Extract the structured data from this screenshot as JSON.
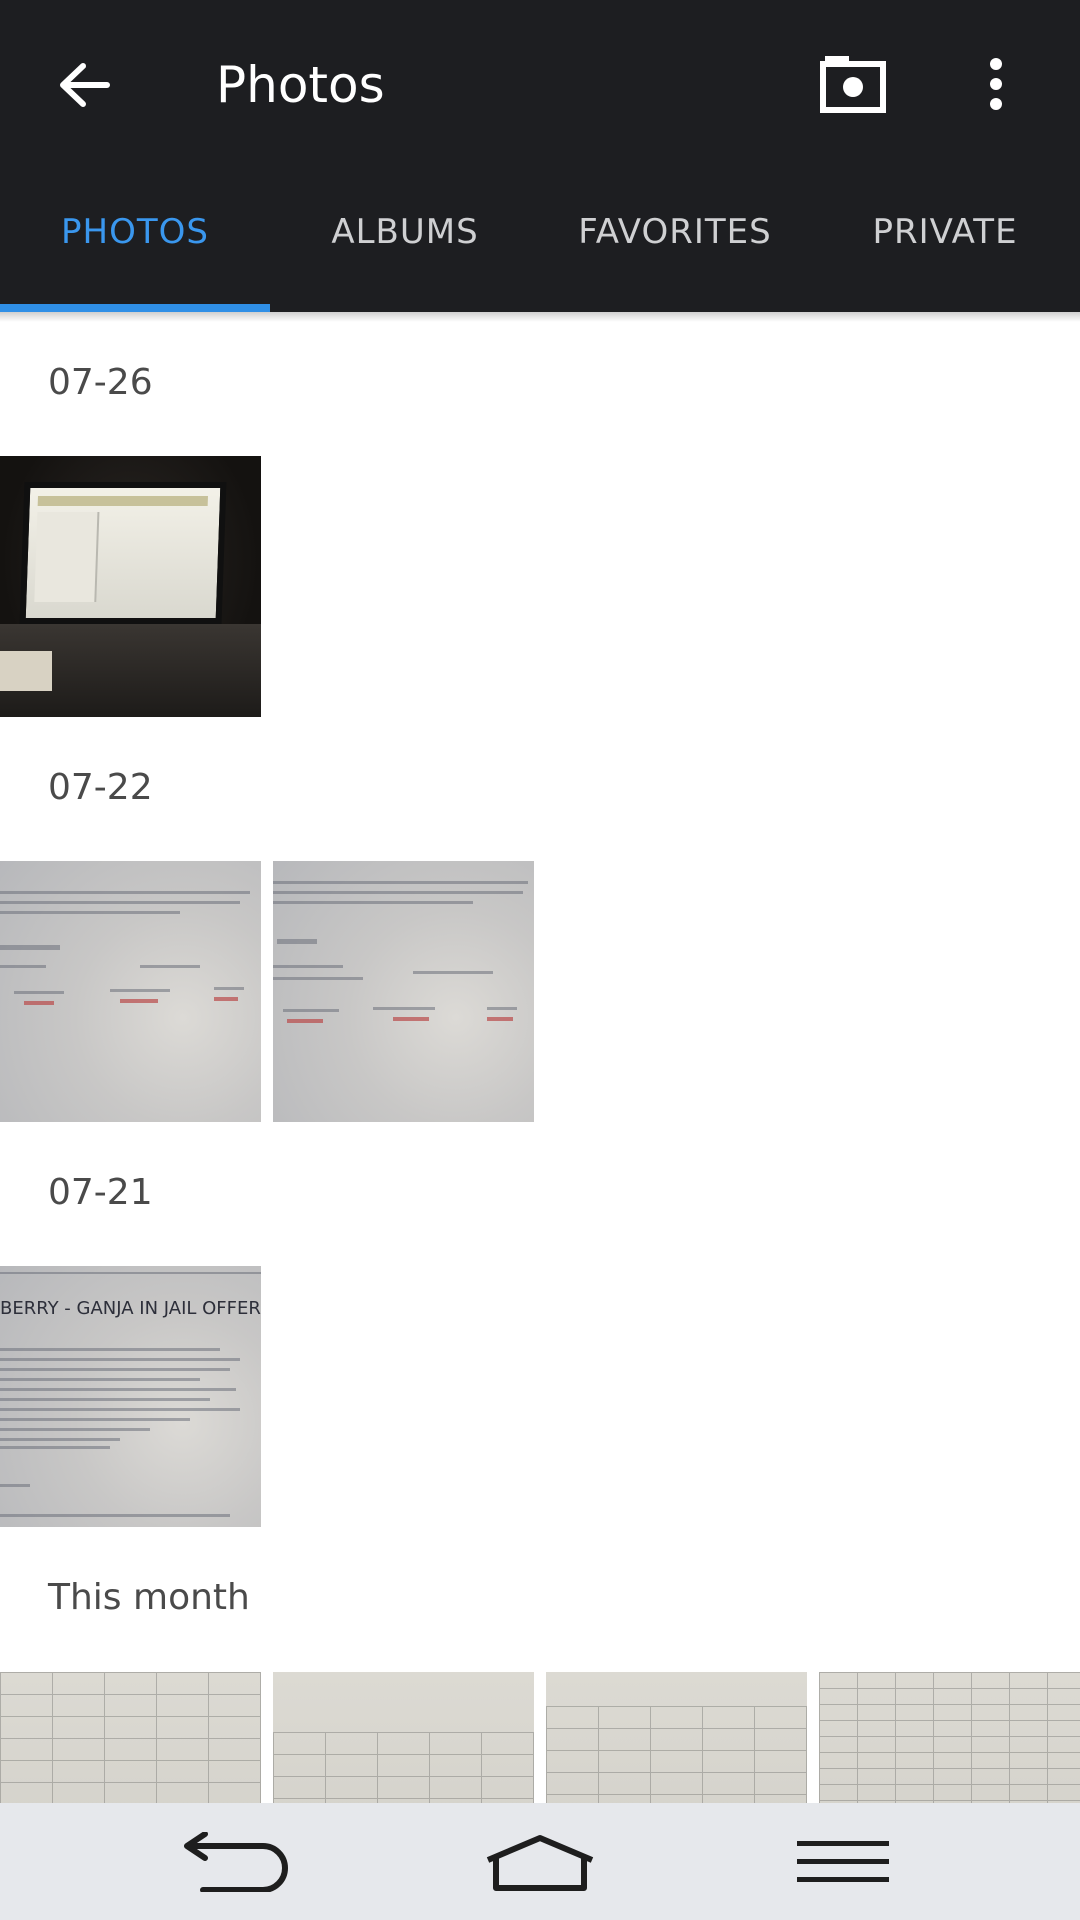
{
  "toolbar": {
    "title": "Photos",
    "back_icon": "arrow-back-icon",
    "camera_icon": "camera-icon",
    "more_icon": "more-vert-icon"
  },
  "tabs": [
    {
      "label": "PHOTOS",
      "active": true
    },
    {
      "label": "ALBUMS",
      "active": false
    },
    {
      "label": "FAVORITES",
      "active": false
    },
    {
      "label": "PRIVATE",
      "active": false
    }
  ],
  "sections": [
    {
      "header": "07-26"
    },
    {
      "header": "07-22"
    },
    {
      "header": "07-21"
    },
    {
      "header": "This month"
    }
  ],
  "thumb_text": {
    "offer_title": "BERRY - GANJA IN JAIL OFFER"
  },
  "colors": {
    "toolbar_bg": "#1d1e21",
    "accent": "#3a97ee",
    "navbar_bg": "#e6e8ec"
  },
  "navbar": {
    "back_icon": "nav-back-icon",
    "home_icon": "nav-home-icon",
    "menu_icon": "nav-menu-icon"
  }
}
